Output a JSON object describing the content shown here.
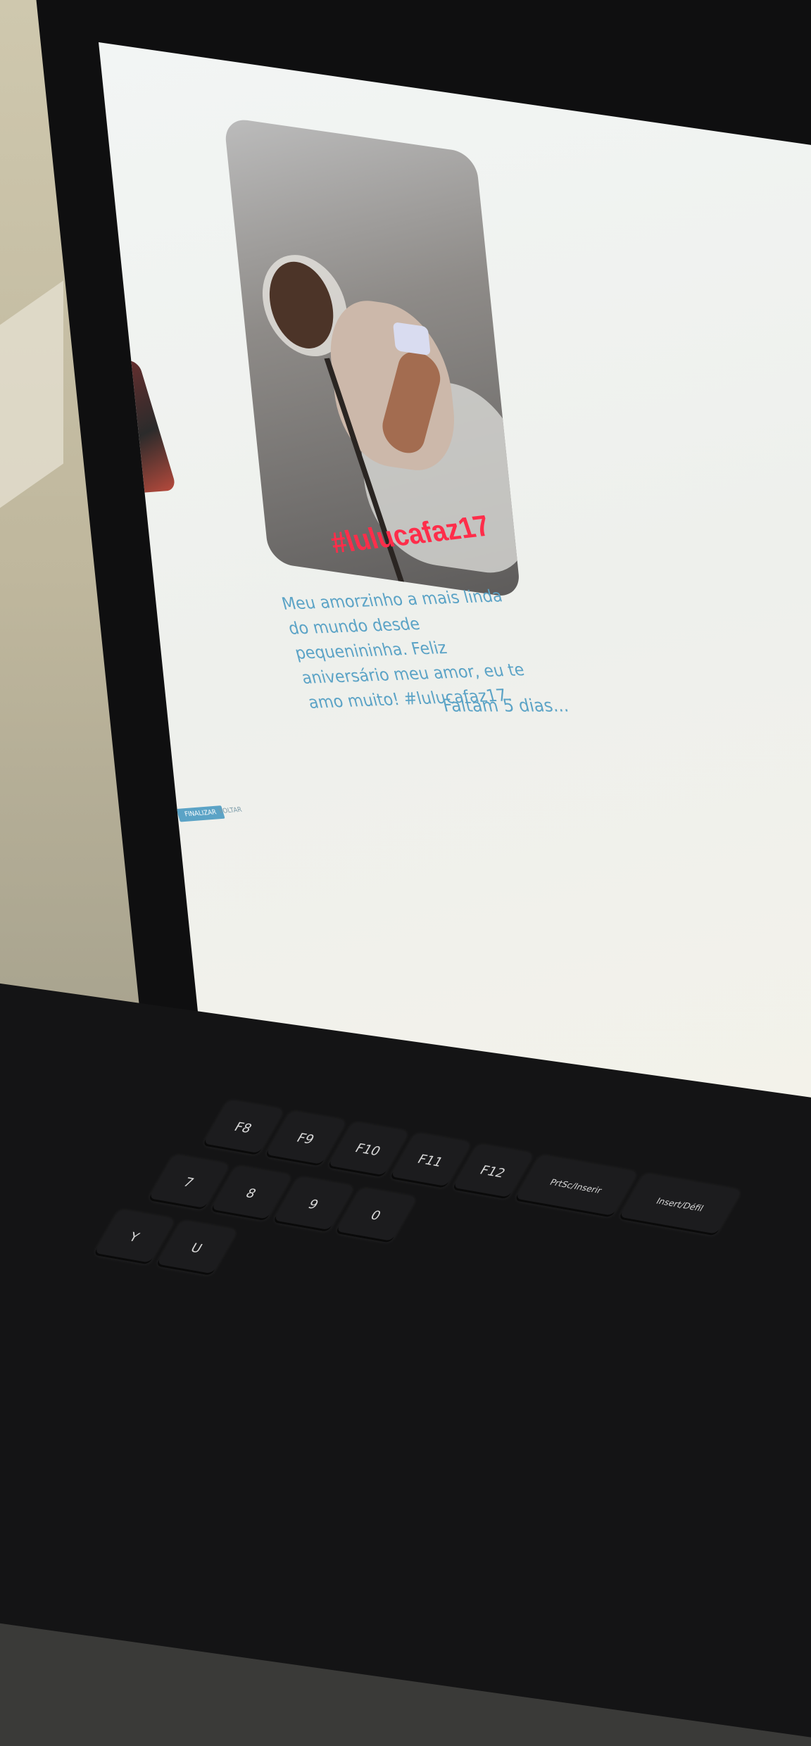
{
  "story": {
    "hashtag": "#lulucafaz17",
    "caption": "Meu amorzinho a mais linda do mundo desde pequenininha. Feliz aniversário meu amor, eu te amo muito! #lulucafaz17.",
    "countdown": "Faltam 5 dias..."
  },
  "side_panel": {
    "button_label": "FINALIZAR",
    "link_label": "VOLTAR"
  },
  "keyboard": {
    "function_row": [
      "F8",
      "F9",
      "F10",
      "F11",
      "F12",
      "PrtSc/Inserir",
      "Insert/Défil"
    ],
    "number_row": [
      "7",
      "8",
      "9",
      "0"
    ],
    "letter_row": [
      "Y",
      "U"
    ]
  },
  "colors": {
    "accent": "#5ba3c6",
    "hashtag": "#ff2d4a"
  }
}
